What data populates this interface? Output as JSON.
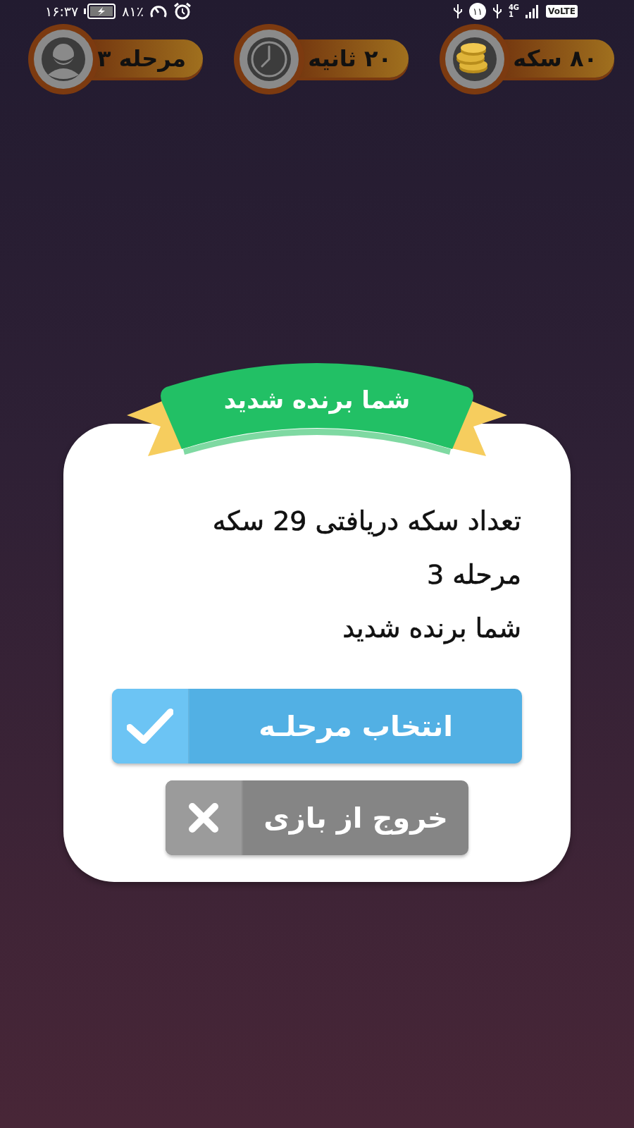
{
  "status_bar": {
    "time": "۱۶:۳۷",
    "battery": "۸۱٪",
    "notification_count": "۱۱",
    "network": "4G",
    "sim": "1",
    "volte": "VoLTE"
  },
  "stats": [
    {
      "kind": "coins",
      "label": "۸۰ سکه"
    },
    {
      "kind": "timer",
      "label": "۲۰ ثانیه"
    },
    {
      "kind": "stage",
      "label": "مرحله ۳"
    }
  ],
  "dialog": {
    "ribbon": "شما برنده شدید",
    "lines": [
      "تعداد سکه دریافتی 29 سکه",
      "مرحله 3",
      "شما برنده شدید"
    ],
    "buttons": [
      {
        "kind": "confirm",
        "label": "انتخاب مرحلـه"
      },
      {
        "kind": "exit",
        "label": "خروج از بازی"
      }
    ]
  }
}
